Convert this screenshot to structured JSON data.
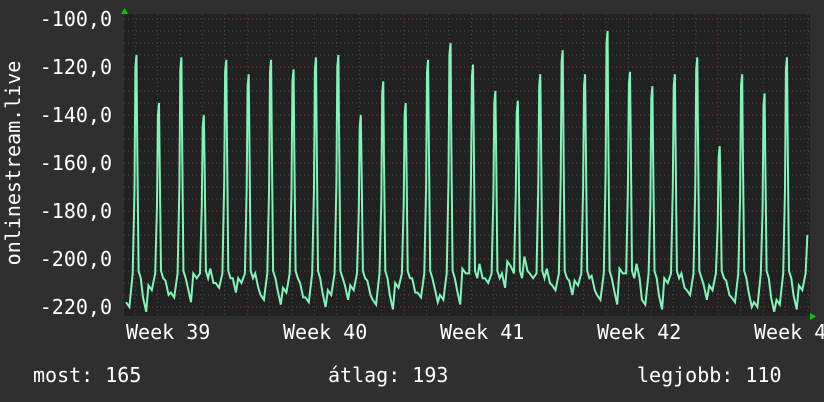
{
  "chart_data": {
    "type": "line",
    "ylabel": "onlinestream.live",
    "ylim": [
      -220,
      -100
    ],
    "yticks": [
      "-100,0",
      "-120,0",
      "-140,0",
      "-160,0",
      "-180,0",
      "-200,0",
      "-220,0"
    ],
    "ytick_values": [
      -100,
      -120,
      -140,
      -160,
      -180,
      -200,
      -220
    ],
    "xticks": [
      "Week 39",
      "Week 40",
      "Week 41",
      "Week 42",
      "Week 4"
    ],
    "grid": true,
    "line_color": "#7ff5b8",
    "x_unit": "days",
    "x_range_days": [
      0,
      30.6
    ],
    "series": [
      {
        "name": "onlinestream.live",
        "daily_peaks": [
          -120,
          -140,
          -121,
          -145,
          -122,
          -128,
          -122,
          -126,
          -121,
          -120,
          -145,
          -131,
          -140,
          -122,
          -115,
          -124,
          -135,
          -139,
          -128,
          -118,
          -128,
          -110,
          -127,
          -133,
          -128,
          -121,
          -158,
          -128,
          -136,
          -121,
          -165
        ],
        "daily_troughs": [
          -222,
          -215,
          -218,
          -210,
          -214,
          -212,
          -219,
          -216,
          -220,
          -217,
          -215,
          -221,
          -214,
          -218,
          -219,
          -208,
          -212,
          -205,
          -210,
          -215,
          -213,
          -219,
          -208,
          -221,
          -212,
          -217,
          -215,
          -220,
          -222,
          -221,
          -215
        ]
      }
    ]
  },
  "legend": {
    "current": "most: 165",
    "average": "átlag: 193",
    "best": "legjobb: 110"
  }
}
